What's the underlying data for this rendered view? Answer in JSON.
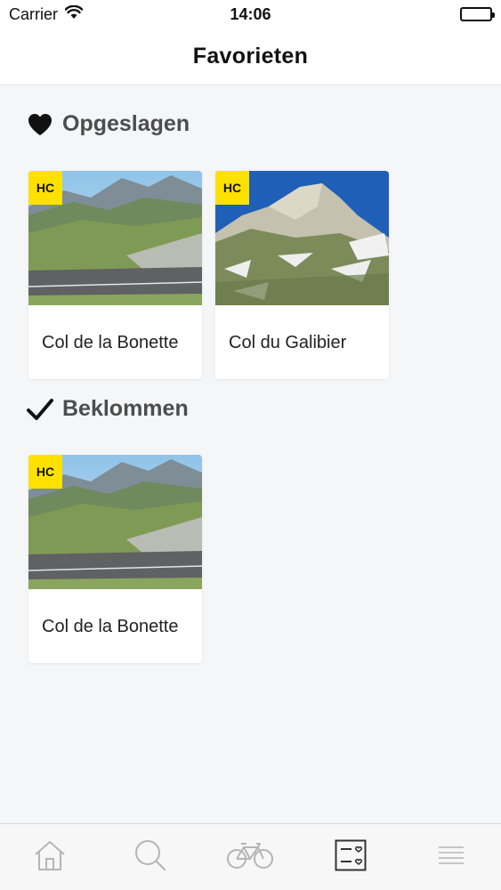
{
  "status_bar": {
    "carrier": "Carrier",
    "time": "14:06",
    "icons": [
      "wifi-icon",
      "battery-icon"
    ]
  },
  "nav": {
    "title": "Favorieten"
  },
  "sections": [
    {
      "title": "Opgeslagen",
      "icon": "heart-icon",
      "cards": [
        {
          "badge": "HC",
          "title": "Col de la Bonette"
        },
        {
          "badge": "HC",
          "title": "Col du Galibier"
        }
      ]
    },
    {
      "title": "Beklommen",
      "icon": "checkmark-icon",
      "cards": [
        {
          "badge": "HC",
          "title": "Col de la Bonette"
        }
      ]
    }
  ],
  "tab_bar": {
    "tabs": [
      {
        "icon": "home-icon",
        "active": false
      },
      {
        "icon": "search-icon",
        "active": false
      },
      {
        "icon": "bicycle-icon",
        "active": false
      },
      {
        "icon": "favorites-list-icon",
        "active": true
      },
      {
        "icon": "menu-icon",
        "active": false
      }
    ]
  },
  "colors": {
    "badge": "#ffe100",
    "active_tab": "#333333",
    "inactive_tab": "#b5b5b5"
  }
}
